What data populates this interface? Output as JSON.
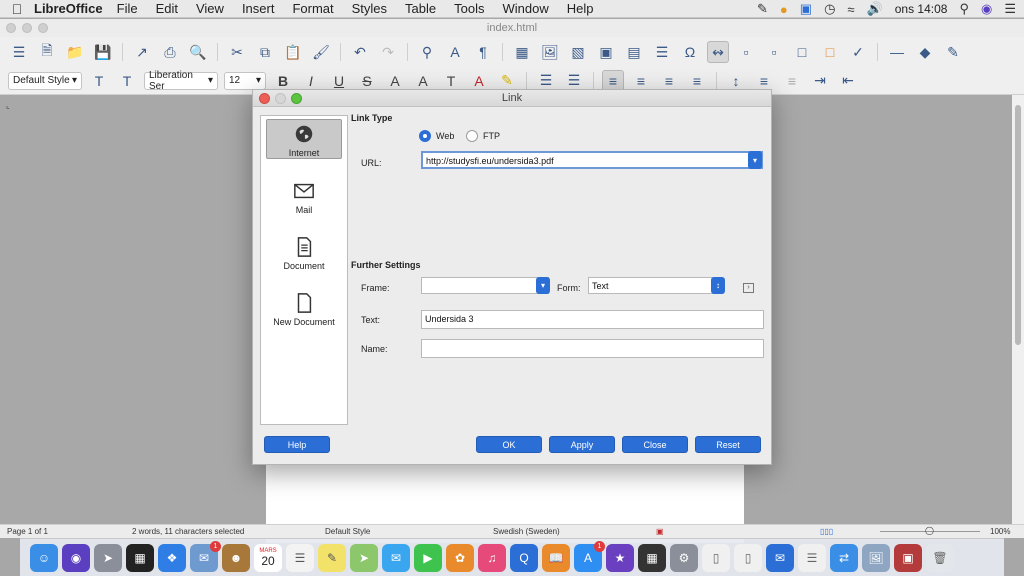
{
  "menubar": {
    "app_name": "LibreOffice",
    "items": [
      "File",
      "Edit",
      "View",
      "Insert",
      "Format",
      "Styles",
      "Table",
      "Tools",
      "Window",
      "Help"
    ],
    "clock": "ons 14:08",
    "status_icons": [
      "pen-icon",
      "ring-icon",
      "box-icon",
      "time-machine-icon",
      "wifi-icon",
      "volume-icon"
    ]
  },
  "window": {
    "title": "index.html"
  },
  "formatting": {
    "paragraph_style": "Default Style",
    "font_name": "Liberation Ser",
    "font_size": "12"
  },
  "dialog": {
    "title": "Link",
    "sidebar": [
      {
        "label": "Internet",
        "icon": "globe-icon",
        "selected": true
      },
      {
        "label": "Mail",
        "icon": "envelope-icon",
        "selected": false
      },
      {
        "label": "Document",
        "icon": "document-icon",
        "selected": false
      },
      {
        "label": "New Document",
        "icon": "new-document-icon",
        "selected": false
      }
    ],
    "link_type": {
      "heading": "Link Type",
      "web_label": "Web",
      "ftp_label": "FTP",
      "selected": "Web",
      "url_label": "URL:",
      "url_value": "http://studysfi.eu/undersida3.pdf"
    },
    "further_settings": {
      "heading": "Further Settings",
      "frame_label": "Frame:",
      "frame_value": "",
      "form_label": "Form:",
      "form_value": "Text",
      "text_label": "Text:",
      "text_value": "Undersida 3",
      "name_label": "Name:",
      "name_value": ""
    },
    "buttons": {
      "help": "Help",
      "ok": "OK",
      "apply": "Apply",
      "close": "Close",
      "reset": "Reset"
    }
  },
  "statusbar": {
    "page": "Page 1 of 1",
    "selection": "2 words, 11 characters selected",
    "style": "Default Style",
    "language": "Swedish (Sweden)",
    "zoom": "100%"
  },
  "dock": {
    "calendar_month": "MARS",
    "calendar_day": "20",
    "badge_count": "1"
  },
  "colors": {
    "accent": "#2b6fd6",
    "focus_ring": "#6d98d8"
  }
}
